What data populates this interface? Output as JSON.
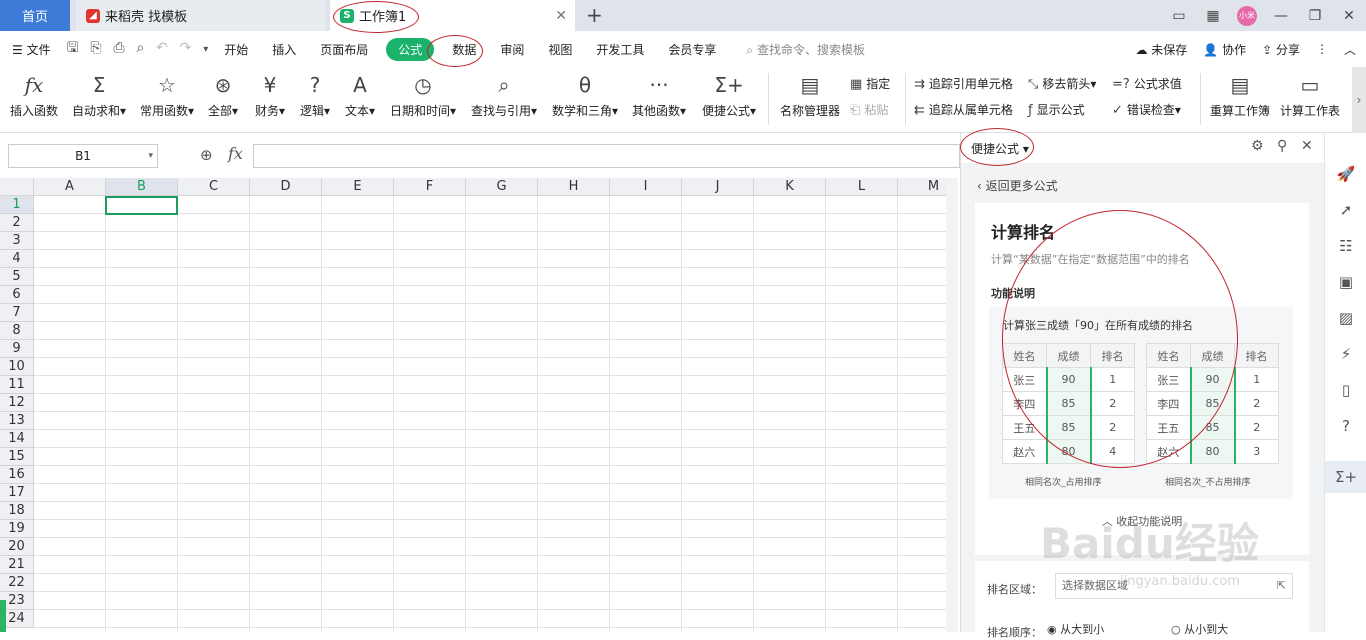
{
  "tabs": {
    "home": "首页",
    "template_tab": "来稻壳 找模板",
    "workbook_tab": "工作簿1"
  },
  "window": {
    "avatar": "小米"
  },
  "menu": {
    "file": "文件",
    "items": [
      "开始",
      "插入",
      "页面布局",
      "公式",
      "数据",
      "审阅",
      "视图",
      "开发工具",
      "会员专享"
    ],
    "active": "公式",
    "search": "查找命令、搜索模板",
    "unsaved": "未保存",
    "collab": "协作",
    "share": "分享"
  },
  "ribbon": {
    "insert_fn": "插入函数",
    "autosum": "自动求和",
    "common_fn": "常用函数",
    "all": "全部",
    "finance": "财务",
    "logic": "逻辑",
    "text": "文本",
    "datetime": "日期和时间",
    "lookup": "查找与引用",
    "math": "数学和三角",
    "other_fn": "其他函数",
    "quick_formula": "便捷公式",
    "name_mgr": "名称管理器",
    "specify": "指定",
    "paste": "粘贴",
    "trace_pre": "追踪引用单元格",
    "trace_dep": "追踪从属单元格",
    "remove_arrows": "移去箭头",
    "show_formula": "显示公式",
    "eval_formula": "公式求值",
    "error_check": "错误检查",
    "recalc_wb": "重算工作簿",
    "calc_sheet": "计算工作表"
  },
  "formula_bar": {
    "name_box": "B1",
    "fx": "fx",
    "value": ""
  },
  "grid": {
    "columns": [
      "A",
      "B",
      "C",
      "D",
      "E",
      "F",
      "G",
      "H",
      "I",
      "J",
      "K",
      "L",
      "M"
    ],
    "rows": [
      "1",
      "2",
      "3",
      "4",
      "5",
      "6",
      "7",
      "8",
      "9",
      "10",
      "11",
      "12",
      "13",
      "14",
      "15",
      "16",
      "17",
      "18",
      "19",
      "20",
      "21",
      "22",
      "23",
      "24"
    ],
    "selected_col": "B",
    "selected_row": "1"
  },
  "panel": {
    "title": "便捷公式",
    "back": "返回更多公式",
    "heading": "计算排名",
    "desc": "计算“某数据”在指定“数据范围”中的排名",
    "section": "功能说明",
    "example_title": "计算张三成绩「90」在所有成绩的排名",
    "table_header": [
      "姓名",
      "成绩",
      "排名"
    ],
    "table1": [
      [
        "张三",
        "90",
        "1"
      ],
      [
        "李四",
        "85",
        "2"
      ],
      [
        "王五",
        "85",
        "2"
      ],
      [
        "赵六",
        "80",
        "4"
      ]
    ],
    "table2": [
      [
        "张三",
        "90",
        "1"
      ],
      [
        "李四",
        "85",
        "2"
      ],
      [
        "王五",
        "85",
        "2"
      ],
      [
        "赵六",
        "80",
        "3"
      ]
    ],
    "caption1": "相同名次_占用排序",
    "caption2": "相同名次_不占用排序",
    "collapse": "收起功能说明",
    "range_label": "排名区域：",
    "range_placeholder": "选择数据区域",
    "order_label": "排名顺序：",
    "order_desc": "从大到小",
    "order_asc": "从小到大"
  },
  "watermark": {
    "text": "Baidu经验",
    "url": "jingyan.baidu.com"
  },
  "colors": {
    "accent": "#1bb36b",
    "tab_blue": "#3d7bd9",
    "annotation": "#c0232c"
  }
}
